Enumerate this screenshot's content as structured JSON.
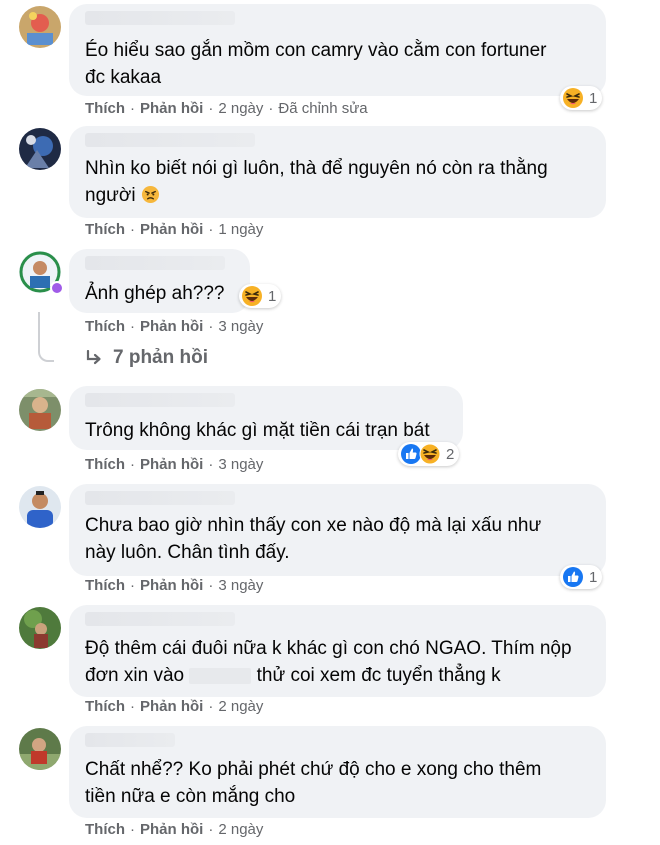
{
  "labels": {
    "like": "Thích",
    "reply": "Phản hồi"
  },
  "comments": [
    {
      "text": "Éo hiểu sao gắn mồm con camry vào cằm con fortuner\nđc kakaa",
      "time": "2 ngày",
      "edited": "Đã chỉnh sửa",
      "reaction_icons": [
        "haha"
      ],
      "reaction_count": "1"
    },
    {
      "text": "Nhìn ko biết nói gì luôn, thà để nguyên nó còn ra thằng\nngười",
      "time": "1 ngày"
    },
    {
      "text": "Ảnh ghép ah???",
      "time": "3 ngày",
      "reaction_icons": [
        "haha"
      ],
      "reaction_count": "1",
      "replies_label": "7 phản hồi"
    },
    {
      "text": "Trông không khác gì mặt tiền cái trạn bát",
      "time": "3 ngày",
      "reaction_icons": [
        "like",
        "haha"
      ],
      "reaction_count": "2"
    },
    {
      "text": "Chưa bao giờ nhìn thấy con xe nào độ mà lại xấu như\nnày luôn. Chân tình đấy.",
      "time": "3 ngày",
      "reaction_icons": [
        "like"
      ],
      "reaction_count": "1"
    },
    {
      "text_part1": "Độ thêm cái đuôi nữa k khác gì con chó NGAO. Thím nộp\nđơn xin vào ",
      "text_part2": " thử coi xem đc tuyển thẳng k",
      "time": "2 ngày"
    },
    {
      "text": "Chất nhể?? Ko phải phét chứ độ cho e xong cho thêm\ntiền nữa e còn mắng cho",
      "time": "2 ngày"
    }
  ],
  "colors": {
    "bubble": "#f0f2f5",
    "secondary_text": "#65676b",
    "like_blue": "#1877f2",
    "haha_yellow": "#f7b125"
  },
  "icons": [
    "haha-emoji-icon",
    "angry-emoji-icon",
    "like-reaction-icon",
    "reply-arrow-icon"
  ]
}
